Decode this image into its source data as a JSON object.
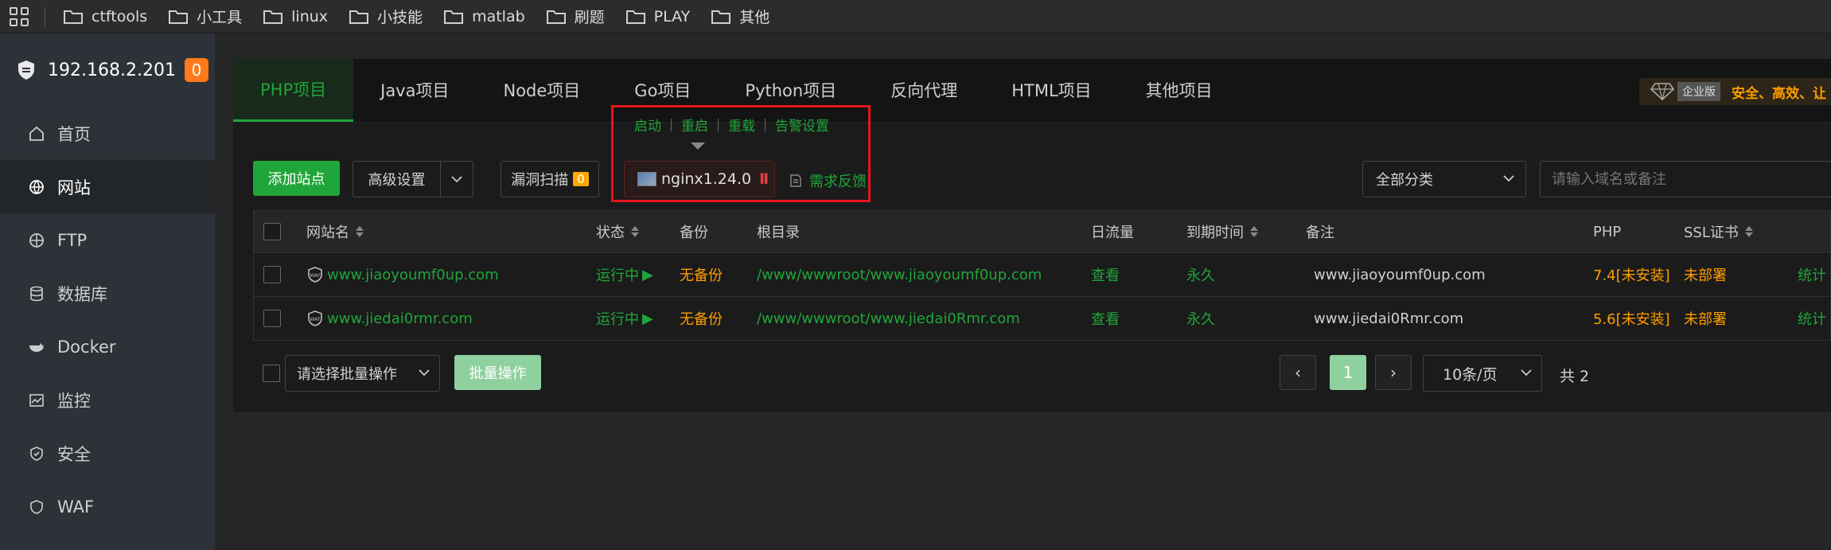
{
  "bookmarks": [
    "ctftools",
    "小工具",
    "linux",
    "小技能",
    "matlab",
    "刷题",
    "PLAY",
    "其他"
  ],
  "sidebar": {
    "host": "192.168.2.201",
    "badge": "0",
    "items": [
      {
        "label": "首页",
        "icon": "home-icon"
      },
      {
        "label": "网站",
        "icon": "globe-icon",
        "active": true
      },
      {
        "label": "FTP",
        "icon": "ftp-icon"
      },
      {
        "label": "数据库",
        "icon": "database-icon"
      },
      {
        "label": "Docker",
        "icon": "docker-icon"
      },
      {
        "label": "监控",
        "icon": "monitor-icon"
      },
      {
        "label": "安全",
        "icon": "shield-icon"
      },
      {
        "label": "WAF",
        "icon": "waf-icon"
      }
    ]
  },
  "tabs": [
    "PHP项目",
    "Java项目",
    "Node项目",
    "Go项目",
    "Python项目",
    "反向代理",
    "HTML项目",
    "其他项目"
  ],
  "enterprise": {
    "label": "企业版",
    "text": "安全、高效、让"
  },
  "service_actions": [
    "启动",
    "重启",
    "重载",
    "告警设置"
  ],
  "toolbar": {
    "add_site": "添加站点",
    "advanced": "高级设置",
    "scan": "漏洞扫描",
    "scan_count": "0",
    "nginx": "nginx1.24.0",
    "nginx_pause": "II",
    "feedback": "需求反馈",
    "category": "全部分类",
    "search_placeholder": "请输入域名或备注"
  },
  "table": {
    "headers": {
      "name": "网站名",
      "status": "状态",
      "backup": "备份",
      "root": "根目录",
      "traffic": "日流量",
      "expire": "到期时间",
      "remark": "备注",
      "php": "PHP",
      "ssl": "SSL证书"
    },
    "rows": [
      {
        "name": "www.jiaoyoumf0up.com",
        "status": "运行中",
        "backup": "无备份",
        "root": "/www/wwwroot/www.jiaoyoumf0up.com",
        "traffic": "查看",
        "expire": "永久",
        "remark": "www.jiaoyoumf0up.com",
        "php": "7.4[未安装]",
        "ssl": "未部署",
        "stat": "统计"
      },
      {
        "name": "www.jiedai0rmr.com",
        "status": "运行中",
        "backup": "无备份",
        "root": "/www/wwwroot/www.jiedai0Rmr.com",
        "traffic": "查看",
        "expire": "永久",
        "remark": "www.jiedai0Rmr.com",
        "php": "5.6[未安装]",
        "ssl": "未部署",
        "stat": "统计"
      }
    ]
  },
  "footer": {
    "batch_select": "请选择批量操作",
    "batch_button": "批量操作",
    "current_page": "1",
    "prev": "‹",
    "next": "›",
    "per_page": "10条/页",
    "total": "共 2"
  }
}
